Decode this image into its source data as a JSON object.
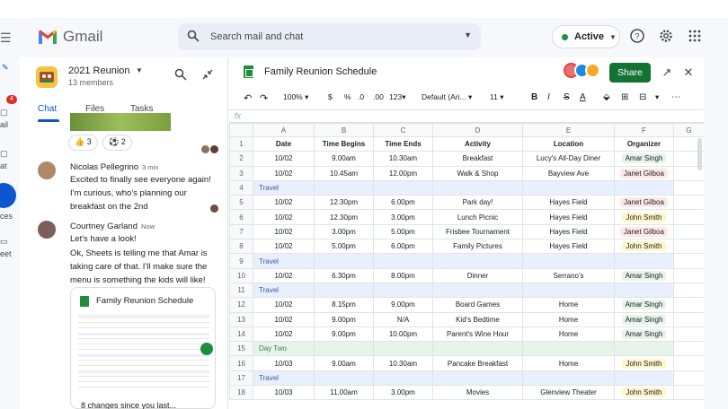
{
  "gmail": {
    "app_name": "Gmail",
    "search_placeholder": "Search mail and chat",
    "status_label": "Active",
    "rail_badge": "4",
    "rail_labels": [
      "ail",
      "at",
      "ces",
      "eet"
    ]
  },
  "chat": {
    "room_name": "2021 Reunion",
    "member_count": "13 members",
    "tabs": [
      "Chat",
      "Files",
      "Tasks"
    ],
    "reactions": [
      {
        "emoji": "👍",
        "count": "3"
      },
      {
        "emoji": "⚽",
        "count": "2"
      }
    ],
    "messages": [
      {
        "author": "Nicolas Pellegrino",
        "time": "3 min",
        "text": "Excited to finally see everyone again! I'm curious, who's planning our breakfast on the 2nd"
      },
      {
        "author": "Courtney Garland",
        "time": "Now",
        "text1": "Let's have a look!",
        "text2": "Ok, Sheets is telling me that Amar is taking care of that. I'll make sure the menu is something the kids will like!"
      }
    ],
    "card_title": "Family Reunion Schedule",
    "changes_text": "8 changes since you last..."
  },
  "sheet": {
    "title": "Family Reunion Schedule",
    "share_label": "Share",
    "toolbar": {
      "zoom": "100%",
      "currency": "$",
      "percent": "%",
      "dec_less": ".0",
      "dec_more": ".00",
      "number_format": "123",
      "font": "Default (Ari...",
      "font_size": "11",
      "bold": "B",
      "italic": "I",
      "strike": "S",
      "text_color": "A",
      "more": "⋯"
    },
    "fx": "fx",
    "col_letters": [
      "A",
      "B",
      "C",
      "D",
      "E",
      "F",
      "G"
    ],
    "headers": [
      "Date",
      "Time Begins",
      "Time Ends",
      "Activity",
      "Location",
      "Organizer"
    ],
    "rows": [
      {
        "n": "2",
        "cells": [
          "10/02",
          "9.00am",
          "10.30am",
          "Breakfast",
          "Lucy's All-Day Diner"
        ],
        "org": "Amar Singh",
        "org_color": "#e6f4ea"
      },
      {
        "n": "3",
        "cells": [
          "10/02",
          "10.45am",
          "12.00pm",
          "Walk & Shop",
          "Bayview Ave"
        ],
        "org": "Janet Gilboa",
        "org_color": "#fce8e6"
      },
      {
        "n": "4",
        "band": "Travel"
      },
      {
        "n": "5",
        "cells": [
          "10/02",
          "12.30pm",
          "6.00pm",
          "Park day!",
          "Hayes Field"
        ],
        "org": "Janet Gilboa",
        "org_color": "#fce8e6"
      },
      {
        "n": "6",
        "cells": [
          "10/02",
          "12.30pm",
          "3.00pm",
          "Lunch Picnic",
          "Hayes Field"
        ],
        "org": "John Smith",
        "org_color": "#fef7cd"
      },
      {
        "n": "7",
        "cells": [
          "10/02",
          "3.00pm",
          "5.00pm",
          "Frisbee Tournament",
          "Hayes Field"
        ],
        "org": "Janet Gilboa",
        "org_color": "#fce8e6"
      },
      {
        "n": "8",
        "cells": [
          "10/02",
          "5.00pm",
          "6.00pm",
          "Family Pictures",
          "Hayes Field"
        ],
        "org": "John Smith",
        "org_color": "#fef7cd"
      },
      {
        "n": "9",
        "band": "Travel"
      },
      {
        "n": "10",
        "cells": [
          "10/02",
          "6.30pm",
          "8.00pm",
          "Dinner",
          "Serrano's"
        ],
        "org": "Amar Singh",
        "org_color": "#e6f4ea"
      },
      {
        "n": "11",
        "band": "Travel"
      },
      {
        "n": "12",
        "cells": [
          "10/02",
          "8.15pm",
          "9.00pm",
          "Board Games",
          "Home"
        ],
        "org": "Amar Singh",
        "org_color": "#e6f4ea"
      },
      {
        "n": "13",
        "cells": [
          "10/02",
          "9.00pm",
          "N/A",
          "Kid's Bedtime",
          "Home"
        ],
        "org": "Amar Singh",
        "org_color": "#e6f4ea"
      },
      {
        "n": "14",
        "cells": [
          "10/02",
          "9.00pm",
          "10.00pm",
          "Parent's Wine Hour",
          "Home"
        ],
        "org": "Amar Singh",
        "org_color": "#e6f4ea"
      },
      {
        "n": "15",
        "band": "Day Two",
        "green": true
      },
      {
        "n": "16",
        "cells": [
          "10/03",
          "9.00am",
          "10.30am",
          "Pancake Breakfast",
          "Home"
        ],
        "org": "John Smith",
        "org_color": "#fef7cd"
      },
      {
        "n": "17",
        "band": "Travel"
      },
      {
        "n": "18",
        "cells": [
          "10/03",
          "11.00am",
          "3.00pm",
          "Movies",
          "Glenview Theater"
        ],
        "org": "John Smith",
        "org_color": "#fef7cd"
      }
    ]
  },
  "colors": {
    "brand_green": "#137333",
    "accent_blue": "#0b57d0",
    "active_dot": "#1e8e3e"
  }
}
